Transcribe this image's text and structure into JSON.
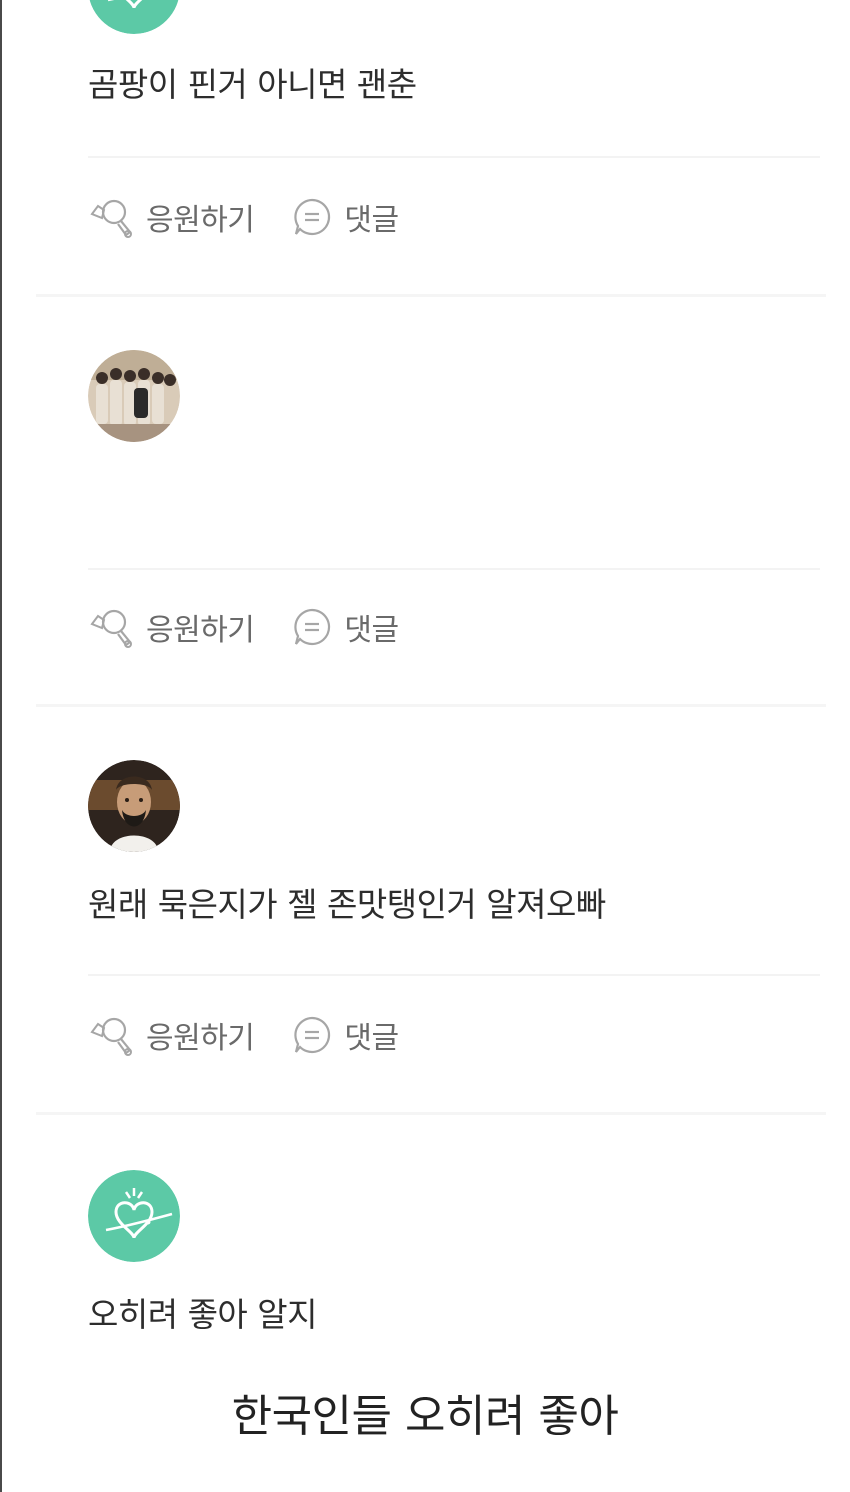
{
  "posts": [
    {
      "avatar": "green-heart-logo-avatar",
      "text": "곰팡이 핀거 아니면 괜춘",
      "cheer_label": "응원하기",
      "comment_label": "댓글"
    },
    {
      "avatar": "group-photo-avatar",
      "text": "",
      "cheer_label": "응원하기",
      "comment_label": "댓글"
    },
    {
      "avatar": "portrait-photo-avatar",
      "text": "원래 묵은지가 젤 존맛탱인거 알져오빠",
      "cheer_label": "응원하기",
      "comment_label": "댓글"
    },
    {
      "avatar": "green-heart-logo-avatar",
      "text": "오히려 좋아 알지"
    }
  ],
  "caption": "한국인들 오히려 좋아",
  "icons": {
    "cheer": "cheer-icon",
    "comment": "comment-icon"
  },
  "colors": {
    "brand_green": "#58c9a3",
    "icon_gray": "#9a9a9a",
    "text": "#2d2d2d"
  }
}
